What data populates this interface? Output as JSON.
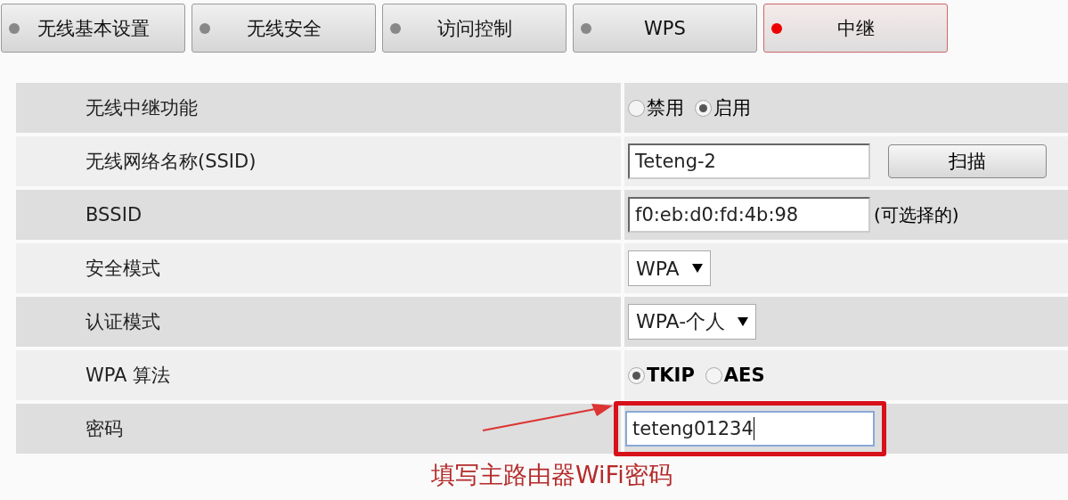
{
  "tabs": [
    {
      "label": "无线基本设置",
      "selected": false
    },
    {
      "label": "无线安全",
      "selected": false
    },
    {
      "label": "访问控制",
      "selected": false
    },
    {
      "label": "WPS",
      "selected": false
    },
    {
      "label": "中继",
      "selected": true
    }
  ],
  "rows": [
    {
      "kind": "radio",
      "label": "无线中继功能",
      "bold": false,
      "options": [
        {
          "label": "禁用",
          "selected": false
        },
        {
          "label": "启用",
          "selected": true
        }
      ]
    },
    {
      "kind": "text",
      "label": "无线网络名称(SSID)",
      "value": "Teteng-2",
      "button": "扫描"
    },
    {
      "kind": "text",
      "label": "BSSID",
      "value": "f0:eb:d0:fd:4b:98",
      "note": "(可选择的)"
    },
    {
      "kind": "select",
      "label": "安全模式",
      "value": "WPA"
    },
    {
      "kind": "select",
      "label": "认证模式",
      "value": "WPA-个人"
    },
    {
      "kind": "radio",
      "label": "WPA 算法",
      "bold": true,
      "options": [
        {
          "label": "TKIP",
          "selected": true
        },
        {
          "label": "AES",
          "selected": false
        }
      ]
    },
    {
      "kind": "text",
      "label": "密码",
      "value": "teteng01234",
      "highlighted": true
    }
  ],
  "callout": {
    "text": "填写主路由器WiFi密码"
  }
}
